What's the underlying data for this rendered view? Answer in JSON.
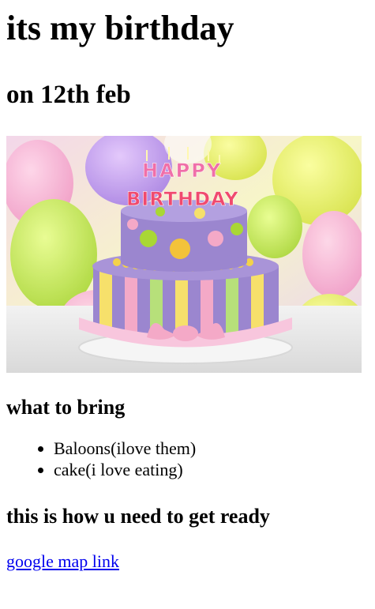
{
  "heading": "its my birthday",
  "subheading": "on 12th feb",
  "image": {
    "cake_topper_line1": "HAPPY",
    "cake_topper_line2": "BIRTHDAY"
  },
  "bring": {
    "title": "what to bring",
    "items": [
      "Baloons(ilove them)",
      "cake(i love eating)"
    ]
  },
  "ready": {
    "title": "this is how u need to get ready",
    "link_label": "google map link"
  },
  "colors": {
    "link": "#0000ee",
    "cake_purple": "#9b86cf",
    "balloon_yellow": "#e9f36a"
  }
}
